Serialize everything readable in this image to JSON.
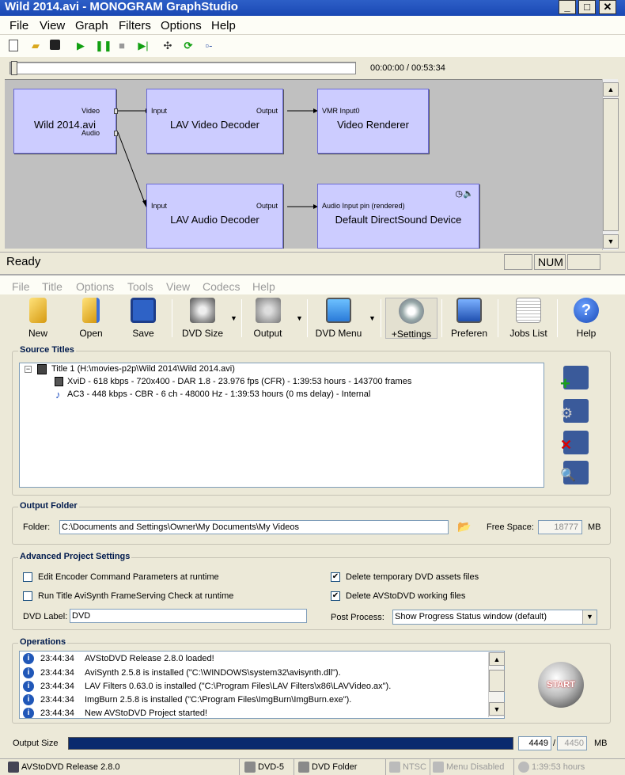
{
  "graphstudio": {
    "title": "Wild 2014.avi - MONOGRAM GraphStudio",
    "window_buttons": [
      "_",
      "□",
      "✕"
    ],
    "menu": [
      "File",
      "View",
      "Graph",
      "Filters",
      "Options",
      "Help"
    ],
    "time": "00:00:00 / 00:53:34",
    "filters": {
      "source": {
        "name": "Wild 2014.avi",
        "pins": [
          "Video",
          "Audio"
        ]
      },
      "video_decoder": {
        "name": "LAV Video Decoder",
        "in": "Input",
        "out": "Output"
      },
      "video_renderer": {
        "name": "Video Renderer",
        "in": "VMR Input0"
      },
      "audio_decoder": {
        "name": "LAV Audio Decoder",
        "in": "Input",
        "out": "Output"
      },
      "audio_renderer": {
        "name": "Default DirectSound Device",
        "in": "Audio Input pin (rendered)"
      }
    },
    "status": "Ready",
    "status_panels": [
      "",
      "NUM",
      ""
    ]
  },
  "avstodvd": {
    "menu": [
      "File",
      "Title",
      "Options",
      "Tools",
      "View",
      "Codecs",
      "Help"
    ],
    "toolbar": {
      "new": "New",
      "open": "Open",
      "save": "Save",
      "dvd_size": "DVD Size",
      "output": "Output",
      "dvd_menu": "DVD Menu",
      "settings": "+Settings",
      "preferences": "Preferen",
      "jobs_list": "Jobs List",
      "help": "Help"
    },
    "source_titles": {
      "heading": "Source Titles",
      "title": "Title 1 (H:\\movies-p2p\\Wild 2014\\Wild 2014.avi)",
      "video": "XviD - 618 kbps - 720x400 - DAR 1.8 - 23.976 fps (CFR) - 1:39:53 hours - 143700 frames",
      "audio": "AC3 - 448 kbps - CBR - 6 ch - 48000 Hz - 1:39:53 hours (0 ms delay) - Internal"
    },
    "output_folder": {
      "heading": "Output Folder",
      "folder_label": "Folder:",
      "folder": "C:\\Documents and Settings\\Owner\\My Documents\\My Videos",
      "free_space_label": "Free Space:",
      "free_space": "18777",
      "unit": "MB"
    },
    "advanced": {
      "heading": "Advanced Project Settings",
      "edit_encoder": {
        "label": "Edit Encoder Command Parameters at runtime",
        "checked": false
      },
      "run_avisynth": {
        "label": "Run Title AviSynth FrameServing Check at runtime",
        "checked": false
      },
      "delete_temp": {
        "label": "Delete temporary DVD assets files",
        "checked": true
      },
      "delete_working": {
        "label": "Delete AVStoDVD working files",
        "checked": true
      },
      "dvd_label_label": "DVD Label:",
      "dvd_label": "DVD",
      "post_process_label": "Post Process:",
      "post_process": "Show Progress Status window (default)"
    },
    "operations": {
      "heading": "Operations",
      "log": [
        {
          "time": "23:44:34",
          "msg": "AVStoDVD Release 2.8.0 loaded!"
        },
        {
          "time": "23:44:34",
          "msg": "AviSynth 2.5.8 is installed (\"C:\\WINDOWS\\system32\\avisynth.dll\")."
        },
        {
          "time": "23:44:34",
          "msg": "LAV Filters 0.63.0 is installed (\"C:\\Program Files\\LAV Filters\\x86\\LAVVideo.ax\")."
        },
        {
          "time": "23:44:34",
          "msg": "ImgBurn 2.5.8 is installed (\"C:\\Program Files\\ImgBurn\\ImgBurn.exe\")."
        },
        {
          "time": "23:44:34",
          "msg": "New AVStoDVD Project started!"
        }
      ],
      "start_label": "START"
    },
    "output_size": {
      "label": "Output Size",
      "used": "4449",
      "sep": "/",
      "total": "4450",
      "unit": "MB",
      "fill": 0.9998
    },
    "statusbar": {
      "release": "AVStoDVD Release 2.8.0",
      "dvd5": "DVD-5",
      "dvd_folder": "DVD Folder",
      "ntsc": "NTSC",
      "menu": "Menu Disabled",
      "duration": "1:39:53 hours"
    }
  }
}
